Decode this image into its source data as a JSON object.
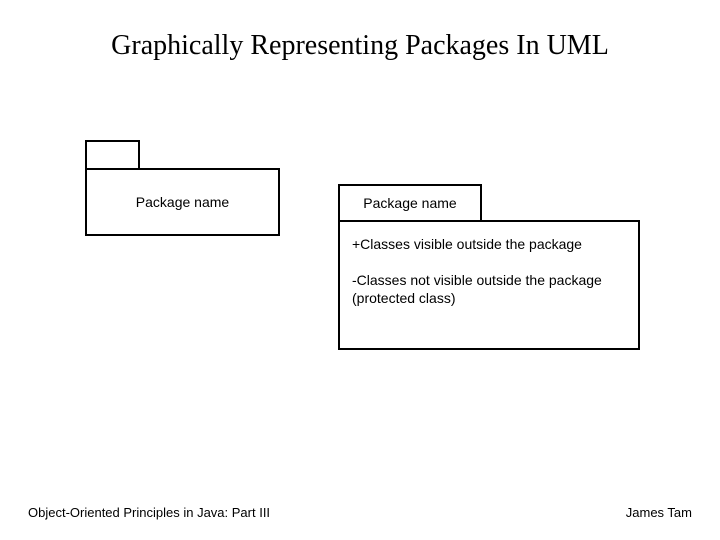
{
  "title": "Graphically Representing Packages In UML",
  "left_package": {
    "label": "Package name"
  },
  "right_package": {
    "label": "Package name",
    "visible_line": "+Classes visible outside the package",
    "hidden_line": "-Classes not visible outside the package (protected class)"
  },
  "footer": {
    "left": "Object-Oriented Principles in Java: Part III",
    "right": "James Tam"
  }
}
